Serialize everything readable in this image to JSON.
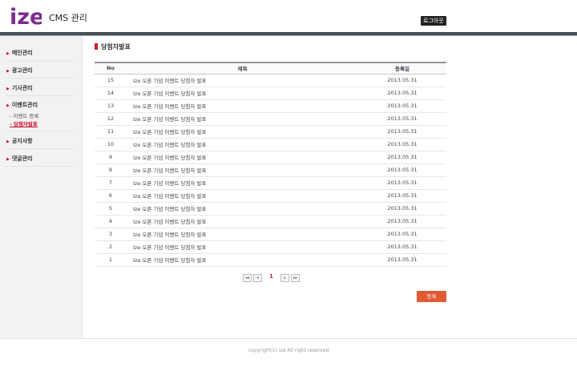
{
  "header": {
    "logo_text": "ize",
    "title": "CMS 관리",
    "logout_label": "로그아웃",
    "brand_color": "#7b2c8f"
  },
  "sidebar": {
    "items": [
      {
        "label": "메인관리"
      },
      {
        "label": "광고관리"
      },
      {
        "label": "기사관리"
      },
      {
        "label": "이벤트관리"
      },
      {
        "label": "공지사항"
      },
      {
        "label": "댓글관리"
      }
    ],
    "event_sub_items": [
      {
        "label": "- 이벤트 등록",
        "active": false
      },
      {
        "label": "- 당첨자발표",
        "active": true
      }
    ]
  },
  "main": {
    "section_title": "당첨자발표",
    "table": {
      "columns": [
        "No",
        "제목",
        "등록일"
      ],
      "rows": [
        {
          "no": "15",
          "title": "Ize 오픈 기념 이벤트 당첨자 발표",
          "date": "2013.05.31"
        },
        {
          "no": "14",
          "title": "Ize 오픈 기념 이벤트 당첨자 발표",
          "date": "2013.05.31"
        },
        {
          "no": "13",
          "title": "Ize 오픈 기념 이벤트 당첨자 발표",
          "date": "2013.05.31"
        },
        {
          "no": "12",
          "title": "Ize 오픈 기념 이벤트 당첨자 발표",
          "date": "2013.05.31"
        },
        {
          "no": "11",
          "title": "Ize 오픈 기념 이벤트 당첨자 발표",
          "date": "2013.05.31"
        },
        {
          "no": "10",
          "title": "Ize 오픈 기념 이벤트 당첨자 발표",
          "date": "2013.05.31"
        },
        {
          "no": "9",
          "title": "Ize 오픈 기념 이벤트 당첨자 발표",
          "date": "2013.05.31"
        },
        {
          "no": "8",
          "title": "Ize 오픈 기념 이벤트 당첨자 발표",
          "date": "2013.05.31"
        },
        {
          "no": "7",
          "title": "Ize 오픈 기념 이벤트 당첨자 발표",
          "date": "2013.05.31"
        },
        {
          "no": "6",
          "title": "Ize 오픈 기념 이벤트 당첨자 발표",
          "date": "2013.05.31"
        },
        {
          "no": "5",
          "title": "Ize 오픈 기념 이벤트 당첨자 발표",
          "date": "2013.05.31"
        },
        {
          "no": "4",
          "title": "Ize 오픈 기념 이벤트 당첨자 발표",
          "date": "2013.05.31"
        },
        {
          "no": "3",
          "title": "Ize 오픈 기념 이벤트 당첨자 발표",
          "date": "2013.05.31"
        },
        {
          "no": "2",
          "title": "Ize 오픈 기념 이벤트 당첨자 발표",
          "date": "2013.05.31"
        },
        {
          "no": "1",
          "title": "Ize 오픈 기념 이벤트 당첨자 발표",
          "date": "2013.05.31"
        }
      ]
    },
    "pagination": {
      "first": "◂◂",
      "prev": "◂",
      "current": "1",
      "next": "▸",
      "last": "▸▸"
    },
    "register_label": "등록"
  },
  "footer": {
    "copyright": "copyright(c) Ize All right reserved"
  },
  "colors": {
    "accent_red": "#c8102e",
    "register_button": "#e05a34",
    "top_bar": "#4a4f56"
  }
}
